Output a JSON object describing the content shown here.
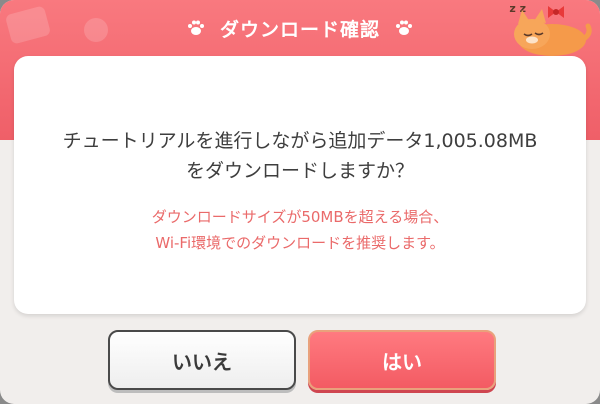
{
  "dialog": {
    "title": "ダウンロード確認",
    "message_lines": [
      "チュートリアルを進行しながら追加データ1,005.08MB",
      "をダウンロードしますか？"
    ],
    "note_lines": [
      "ダウンロードサイズが50MBを超える場合、",
      "Wi-Fi環境でのダウンロードを推奨します。"
    ],
    "buttons": {
      "no": "いいえ",
      "yes": "はい"
    },
    "mascot_icon": "sleeping-cat-icon",
    "decor_icon": "paw-icon"
  },
  "colors": {
    "header": "#f06a71",
    "note_text": "#ea6a6a",
    "yes_button": "#f35b63",
    "panel": "#ffffff"
  }
}
